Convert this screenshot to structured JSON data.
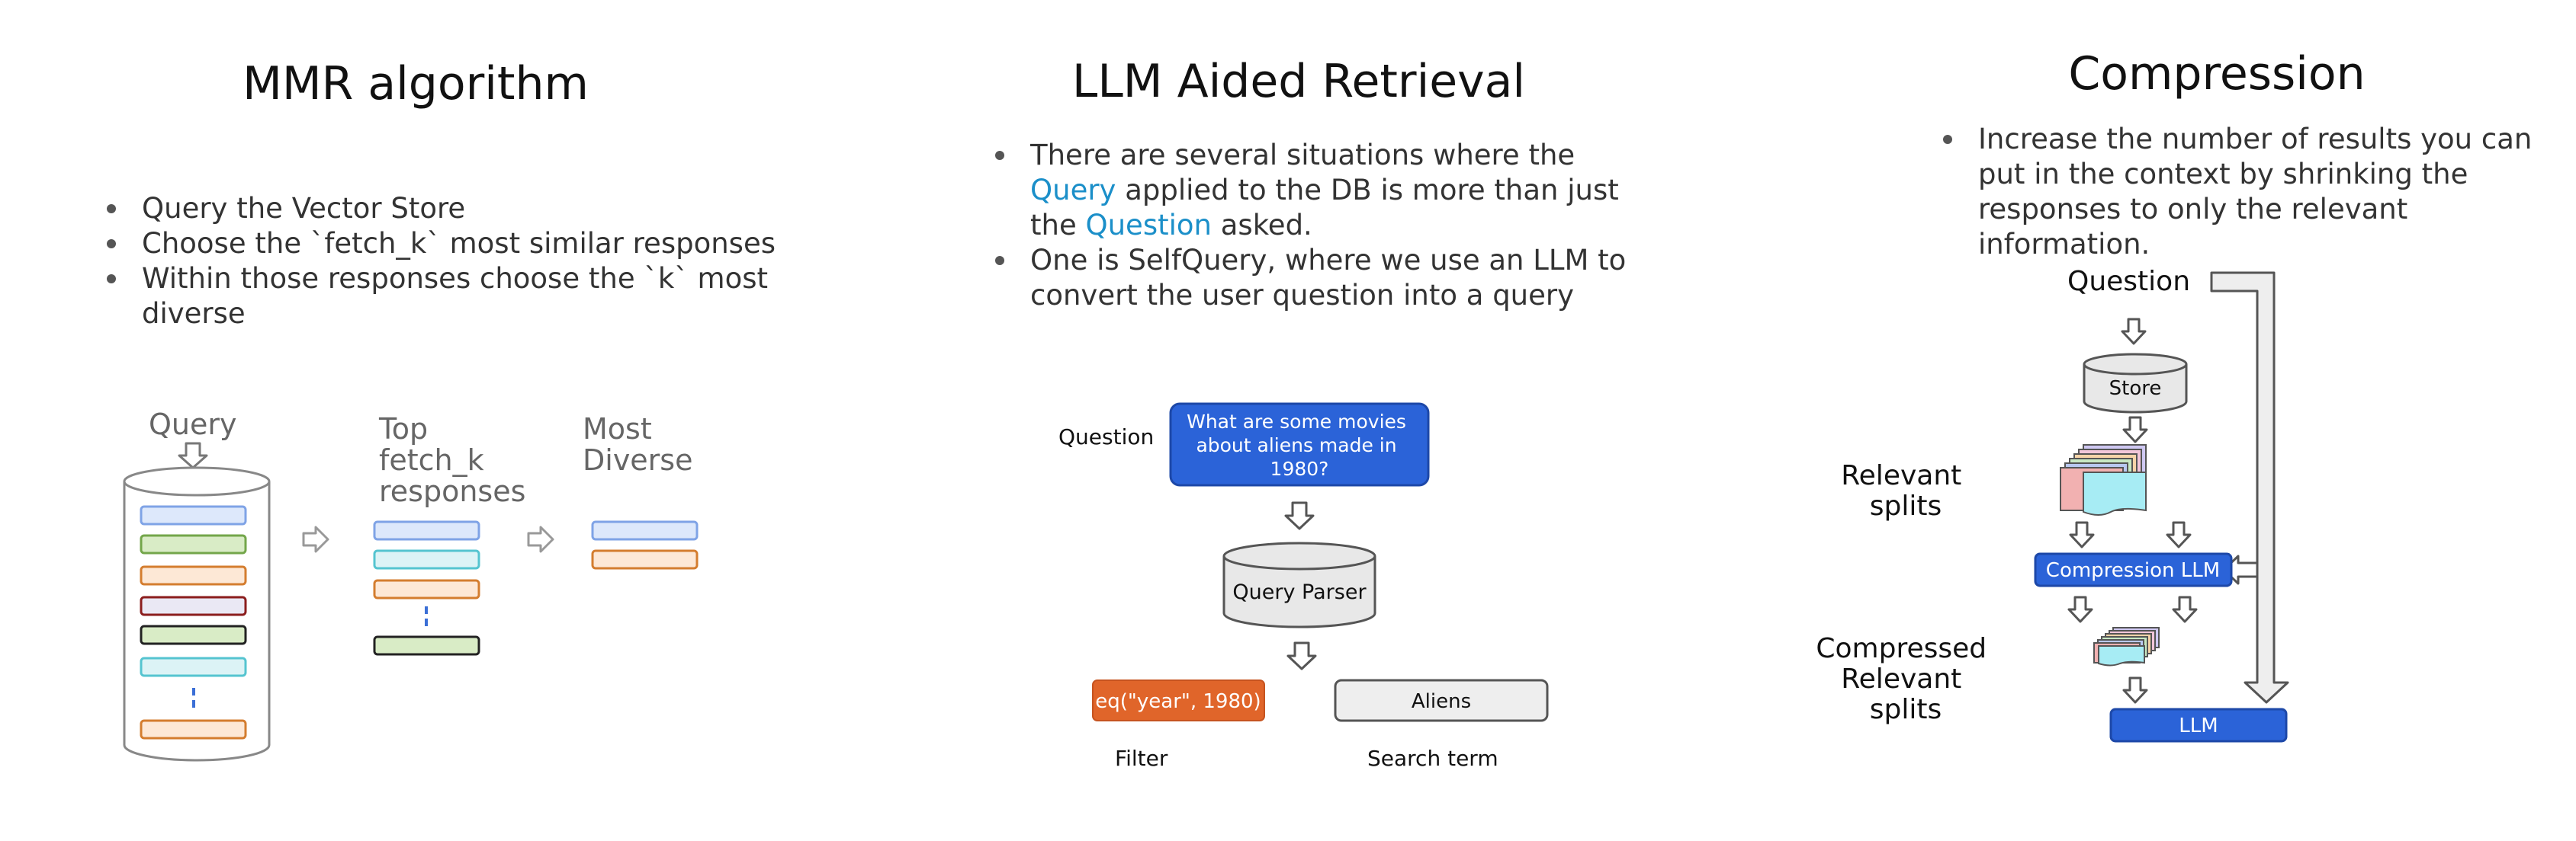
{
  "mmr": {
    "title": "MMR algorithm",
    "bullets": [
      "Query the Vector Store",
      "Choose the `fetch_k` most similar responses",
      "Within those responses choose the `k` most diverse"
    ],
    "diagram": {
      "query_label": "Query",
      "top_label": [
        "Top",
        "fetch_k",
        "responses"
      ],
      "diverse_label": [
        "Most",
        "Diverse"
      ]
    }
  },
  "llm_retrieval": {
    "title": "LLM Aided Retrieval",
    "bullet1": {
      "pre": "There are several situations where the ",
      "query": "Query",
      "mid": " applied to the DB is more than just the ",
      "question": "Question",
      "post": " asked."
    },
    "bullet2": "One is SelfQuery, where we use an LLM to convert the user question into a query",
    "diagram": {
      "question_label": "Question",
      "question_text": [
        "What are some movies",
        "about aliens made in",
        "1980?"
      ],
      "parser_label": "Query Parser",
      "filter_box": "eq(\"year\", 1980)",
      "search_box": "Aliens",
      "filter_label": "Filter",
      "search_label": "Search term"
    }
  },
  "compression": {
    "title": "Compression",
    "bullet": "Increase the number of results you can put in the context by shrinking the responses to only the relevant information.",
    "diagram": {
      "question_label": "Question",
      "store_label": "Store",
      "relevant_label": [
        "Relevant",
        "splits"
      ],
      "compression_llm": "Compression LLM",
      "compressed_label": [
        "Compressed",
        "Relevant",
        "splits"
      ],
      "llm": "LLM"
    }
  },
  "colors": {
    "blue_box": "#2b63d8",
    "orange_box": "#e0652a",
    "link_blue": "#1b8fc9"
  }
}
